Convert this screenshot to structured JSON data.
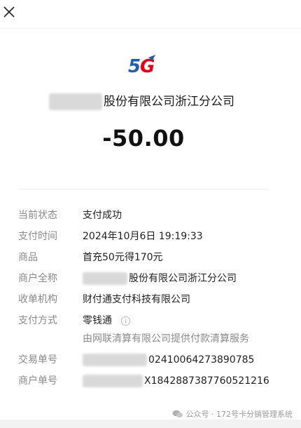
{
  "header": {
    "close_icon": "close-icon"
  },
  "logo": {
    "text": "5G",
    "colors": {
      "blue": "#1f5fae",
      "red": "#e60012"
    }
  },
  "merchant": {
    "name_visible": "股份有限公司浙江分公司"
  },
  "amount": "-50.00",
  "details": [
    {
      "label": "当前状态",
      "value": "支付成功"
    },
    {
      "label": "支付时间",
      "value": "2024年10月6日 19:19:33"
    },
    {
      "label": "商品",
      "value": "首充50元得170元"
    },
    {
      "label": "商户全称",
      "value": "股份有限公司浙江分公司"
    },
    {
      "label": "收单机构",
      "value": "财付通支付科技有限公司"
    },
    {
      "label": "支付方式",
      "value": "零钱通"
    },
    {
      "label": "交易单号",
      "value": "02410064273890785"
    },
    {
      "label": "商户单号",
      "value": "X1842887387760521216"
    }
  ],
  "payment_note": "由网联清算有限公司提供付款清算服务",
  "watermark": "公众号 · 172号卡分销管理系统"
}
